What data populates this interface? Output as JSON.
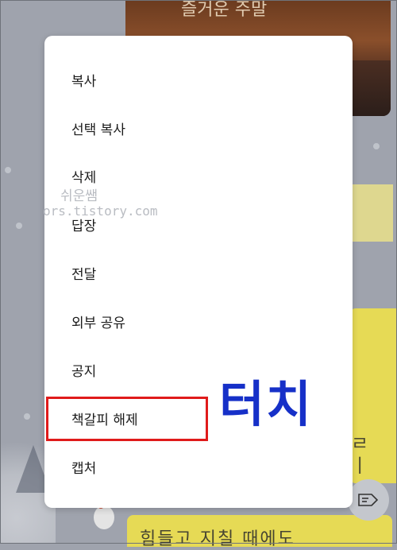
{
  "background": {
    "card_title": "즐거운 주말",
    "bottom_card_text": "힘들고 지칠 때에도",
    "side_chars": [
      "ㄹ",
      "ㅣ"
    ]
  },
  "menu": {
    "items": [
      {
        "label": "복사"
      },
      {
        "label": "선택 복사"
      },
      {
        "label": "삭제"
      },
      {
        "label": "답장"
      },
      {
        "label": "전달"
      },
      {
        "label": "외부 공유"
      },
      {
        "label": "공지"
      },
      {
        "label": "책갈피 해제"
      },
      {
        "label": "캡처"
      }
    ]
  },
  "annotation": {
    "text": "터치",
    "highlight_color": "#e01b1b",
    "text_color": "#1630c8"
  },
  "watermark": {
    "line1": "쉬운쌤",
    "line2": "ors.tistory.com"
  },
  "icons": {
    "share": "share-tag-icon"
  }
}
